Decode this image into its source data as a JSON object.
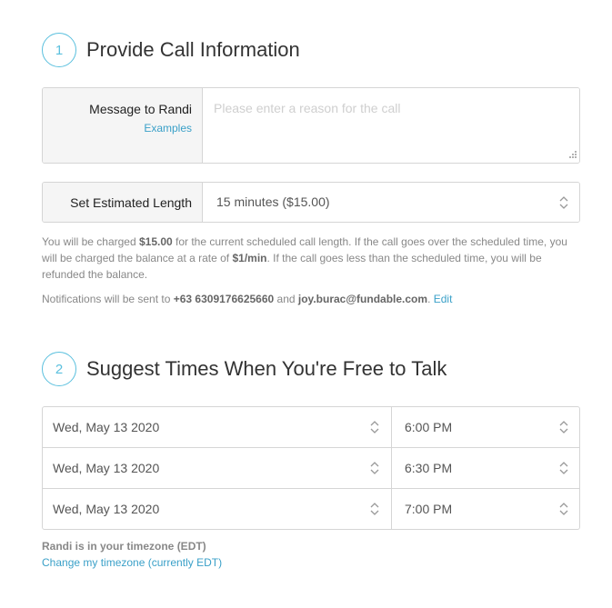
{
  "step1": {
    "number": "1",
    "title": "Provide Call Information",
    "message": {
      "label": "Message to Randi",
      "examples_link": "Examples",
      "placeholder": "Please enter a reason for the call",
      "value": ""
    },
    "length": {
      "label": "Set Estimated Length",
      "selected": "15 minutes ($15.00)"
    },
    "charge_info": {
      "p1": "You will be charged ",
      "amount": "$15.00",
      "p2": " for the current scheduled call length. If the call goes over the scheduled time, you will be charged the balance at a rate of ",
      "rate": "$1/min",
      "p3": ". If the call goes less than the scheduled time, you will be refunded the balance."
    },
    "notifications": {
      "p1": "Notifications will be sent to ",
      "phone": "+63 6309176625660",
      "and": " and ",
      "email": "joy.burac@fundable.com",
      "period": ". ",
      "edit_link": "Edit"
    }
  },
  "step2": {
    "number": "2",
    "title": "Suggest Times When You're Free to Talk",
    "rows": [
      {
        "date": "Wed, May 13 2020",
        "time": "6:00 PM"
      },
      {
        "date": "Wed, May 13 2020",
        "time": "6:30 PM"
      },
      {
        "date": "Wed, May 13 2020",
        "time": "7:00 PM"
      }
    ],
    "timezone_note": "Randi is in your timezone (EDT)",
    "change_timezone_link": "Change my timezone (currently EDT)"
  },
  "colors": {
    "accent": "#5bc0de",
    "link": "#3aa0c8",
    "label_bg": "#f5f5f5",
    "border": "#d5d5d5"
  }
}
